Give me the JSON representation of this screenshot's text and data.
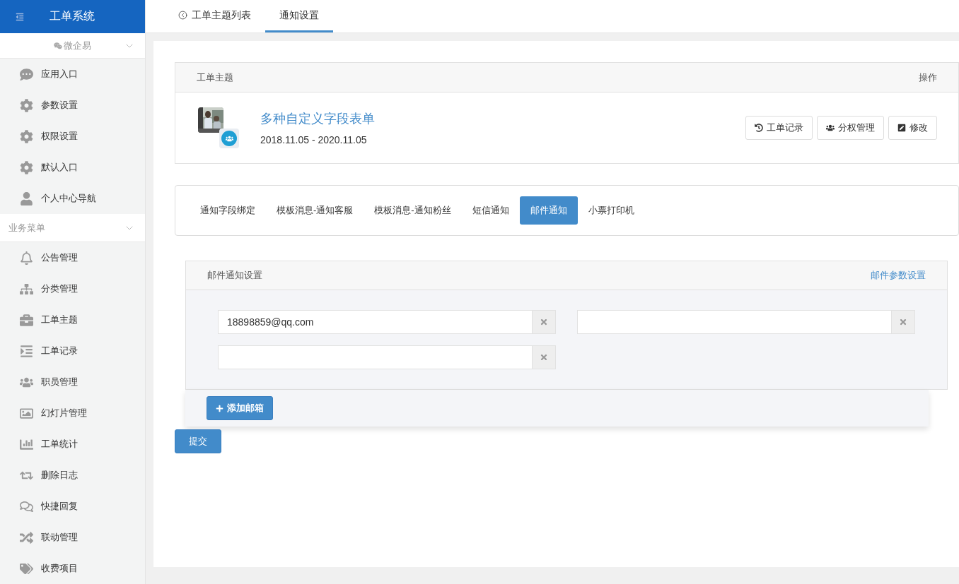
{
  "app": {
    "title": "工单系统"
  },
  "sidebar": {
    "groups": [
      {
        "label": "微企易",
        "expanded": true,
        "items": [
          {
            "label": "应用入口"
          },
          {
            "label": "参数设置"
          },
          {
            "label": "权限设置"
          },
          {
            "label": "默认入口"
          },
          {
            "label": "个人中心导航"
          }
        ]
      },
      {
        "label": "业务菜单",
        "expanded": true,
        "items": [
          {
            "label": "公告管理"
          },
          {
            "label": "分类管理"
          },
          {
            "label": "工单主题"
          },
          {
            "label": "工单记录"
          },
          {
            "label": "职员管理"
          },
          {
            "label": "幻灯片管理"
          },
          {
            "label": "工单统计"
          },
          {
            "label": "删除日志"
          },
          {
            "label": "快捷回复"
          },
          {
            "label": "联动管理"
          },
          {
            "label": "收费项目"
          }
        ]
      }
    ]
  },
  "top_tabs": [
    {
      "label": "工单主题列表",
      "selected": false
    },
    {
      "label": "通知设置",
      "selected": true
    }
  ],
  "topic_table": {
    "columns": [
      "工单主题",
      "操作"
    ],
    "row": {
      "title": "多种自定义字段表单",
      "dates": "2018.11.05 - 2020.11.05",
      "actions": [
        "工单记录",
        "分权管理",
        "修改"
      ]
    }
  },
  "notify_tabs": [
    {
      "label": "通知字段绑定",
      "selected": false
    },
    {
      "label": "模板消息-通知客服",
      "selected": false
    },
    {
      "label": "模板消息-通知粉丝",
      "selected": false
    },
    {
      "label": "短信通知",
      "selected": false
    },
    {
      "label": "邮件通知",
      "selected": true
    },
    {
      "label": "小票打印机",
      "selected": false
    }
  ],
  "email_panel": {
    "title": "邮件通知设置",
    "link": "邮件参数设置",
    "emails": [
      {
        "kind": "filled",
        "value": "18898859@qq.com"
      },
      {
        "kind": "blank"
      },
      {
        "kind": "blank"
      }
    ],
    "add_button": "添加邮箱"
  },
  "submit_button": "提交"
}
